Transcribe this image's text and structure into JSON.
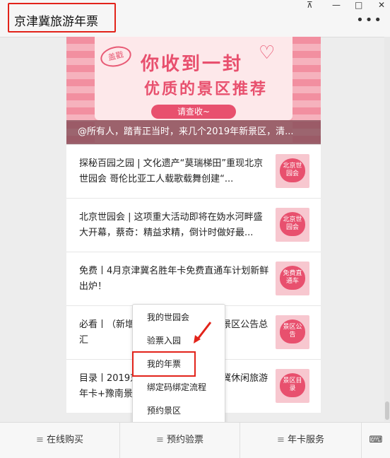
{
  "window": {
    "title": "京津冀旅游年票",
    "pin_icon": "⊼",
    "min_icon": "—",
    "max_icon": "□",
    "close_icon": "✕",
    "more_icon": "•••"
  },
  "banner": {
    "stamp": "盖戳",
    "headline1": "你收到一封",
    "headline2": "优质的景区推荐",
    "button": "请查收~",
    "caption": "@所有人，踏青正当时，来几个2019年新景区，清..."
  },
  "articles": [
    {
      "text": "探秘百园之园 | 文化遗产“莫瑞梯田”重现北京世园会 哥伦比亚工人载歌载舞创建“...",
      "thumb": "北京世园会"
    },
    {
      "text": "北京世园会 | 这项重大活动即将在妫水河畔盛大开幕，蔡奇：精益求精，倒计时做好最...",
      "thumb": "北京世园会"
    },
    {
      "text": "免费丨4月京津冀名胜年卡免费直通车计划新鲜出炉！",
      "thumb": "免费直通车"
    },
    {
      "text": "必看丨（新增）2019年京津冀年卡景区公告总汇",
      "thumb": "景区公告"
    },
    {
      "text": "目录丨2019京津冀旅游年票与京津冀休闲旅游年卡+豫南景区目录",
      "thumb": "景区目录"
    }
  ],
  "menu": {
    "items": [
      "我的世园会",
      "验票入园",
      "我的年票",
      "绑定码绑定流程",
      "预约景区"
    ]
  },
  "bottom_tabs": [
    {
      "label": "在线购买"
    },
    {
      "label": "预约验票"
    },
    {
      "label": "年卡服务"
    }
  ],
  "bottom_keyboard_icon": "⌨",
  "colors": {
    "accent_red": "#e2231a",
    "banner_pink": "#f6a9b5",
    "heart_pink": "#e8506e"
  }
}
